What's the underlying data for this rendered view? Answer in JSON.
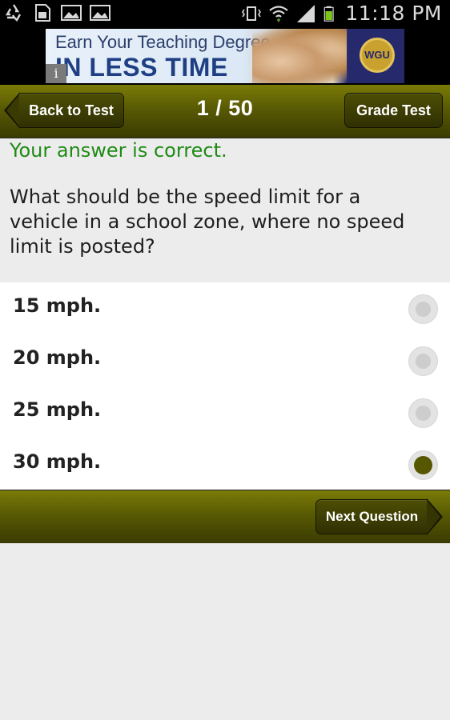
{
  "status_bar": {
    "time": "11:18 PM",
    "left_icons": [
      "recycle-icon",
      "sd-card-icon",
      "image-icon",
      "image-icon"
    ],
    "right_icons": [
      "vibrate-icon",
      "wifi-icon",
      "signal-icon",
      "battery-icon"
    ]
  },
  "ad": {
    "line1": "Earn Your Teaching Degree",
    "line2": "IN LESS TIME",
    "logo_text": "WGU",
    "info_glyph": "i"
  },
  "header": {
    "back_label": "Back to Test",
    "page_count": "1 / 50",
    "grade_label": "Grade Test"
  },
  "question": {
    "feedback": "Your answer is correct.",
    "text": "What should be the speed limit for a vehicle in a school zone, where no speed limit is posted?"
  },
  "answers": [
    {
      "label": "15 mph.",
      "selected": false
    },
    {
      "label": "20 mph.",
      "selected": false
    },
    {
      "label": "25 mph.",
      "selected": false
    },
    {
      "label": "30 mph.",
      "selected": true
    }
  ],
  "footer": {
    "next_label": "Next Question"
  },
  "colors": {
    "olive_bar": "#595a04",
    "correct_green": "#1f8a16",
    "selected_radio": "#565700"
  }
}
